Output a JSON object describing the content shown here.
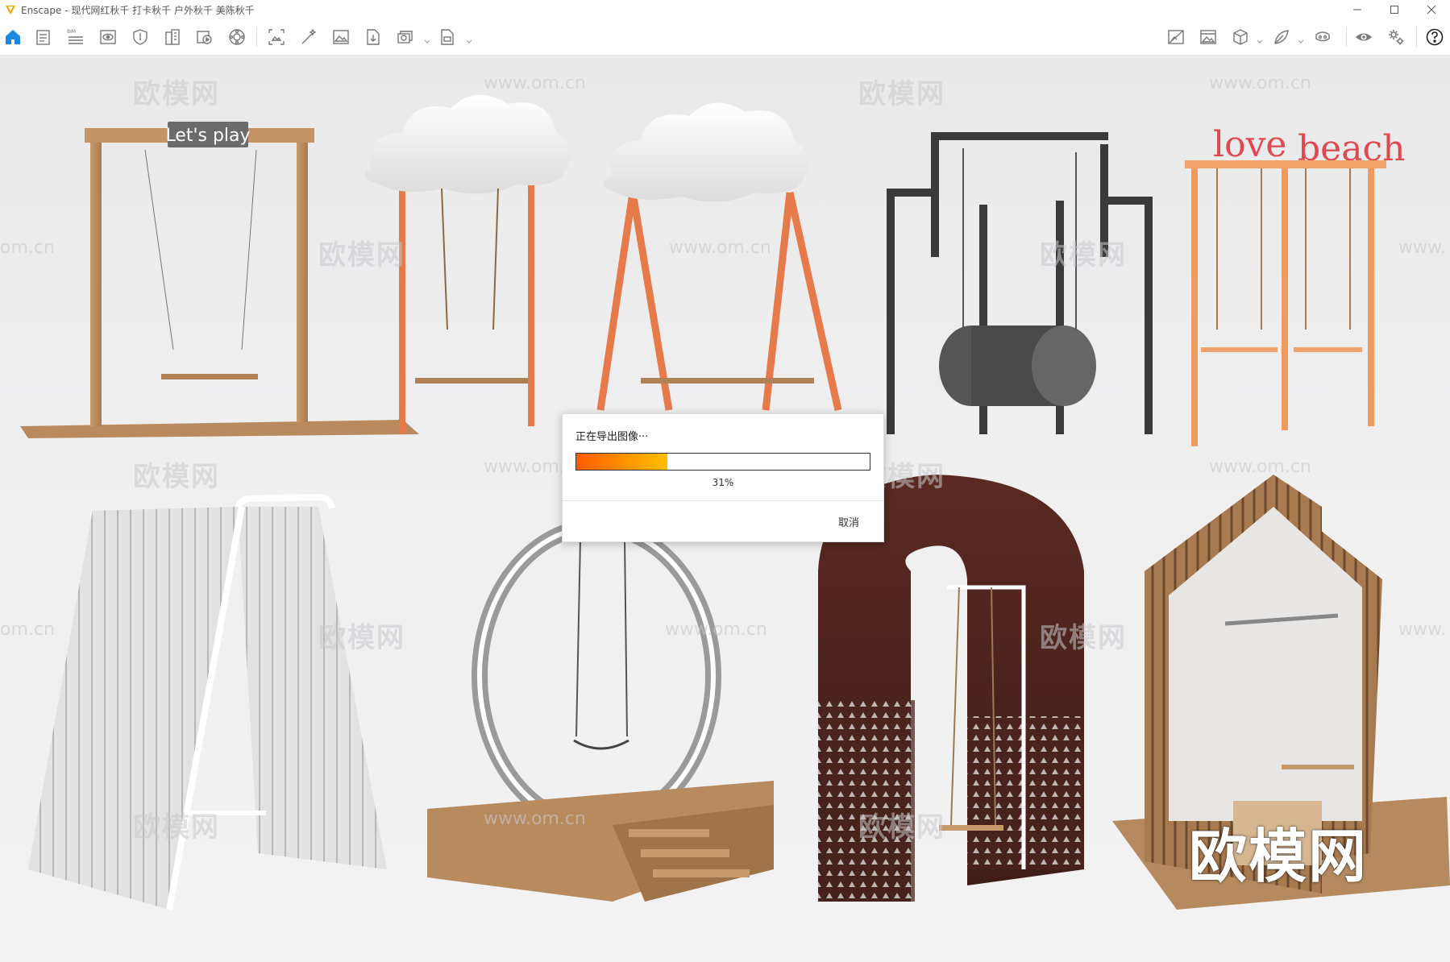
{
  "window": {
    "title": "Enscape - 现代网红秋千 打卡秋千 户外秋千 美陈秋千",
    "controls": [
      "minimize",
      "maximize",
      "close"
    ]
  },
  "toolbar": {
    "left_icons": [
      "home-icon",
      "document-icon",
      "bim-list-icon",
      "eye-view-icon",
      "shield-icon",
      "building-icon",
      "video-editor-icon",
      "panorama-icon",
      "screenshot-icon",
      "magic-wand-icon",
      "image-icon",
      "export-file-icon",
      "batch-render-icon",
      "export-exe-icon"
    ],
    "bim_label": "BIM",
    "right_icons": [
      "no-image-icon",
      "image-gallery-icon",
      "cube-icon",
      "leaf-icon",
      "vr-headset-icon",
      "eye-icon",
      "settings-icon",
      "help-icon"
    ],
    "accent_color": "#1e88e5"
  },
  "viewport": {
    "watermark_text": "欧模网",
    "watermark_url": "www.om.cn",
    "watermark_url_partial": "om.cn",
    "watermark_url_partial_right": "www.",
    "sign_lets_play": "Let's play",
    "sign_love": "love",
    "sign_beach": "beach",
    "big_watermark": "欧模网"
  },
  "dialog": {
    "title": "正在导出图像···",
    "progress": 0.31,
    "progress_label": "31%",
    "cancel_label": "取消"
  }
}
